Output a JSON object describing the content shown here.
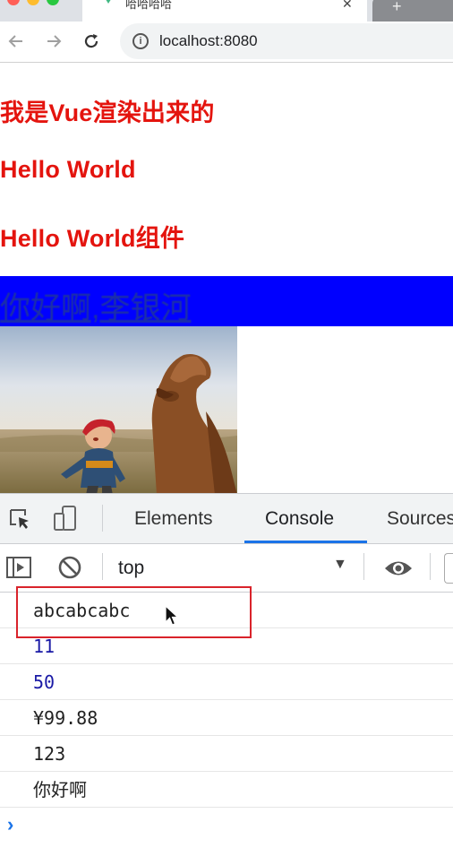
{
  "browser": {
    "tab_title": "哈哈哈哈",
    "url": "localhost:8080"
  },
  "page": {
    "headings": [
      "我是Vue渲染出来的",
      "Hello World",
      "Hello World组件"
    ],
    "blue_link_text": "你好啊,李银河"
  },
  "devtools": {
    "tabs": [
      "Elements",
      "Console",
      "Sources"
    ],
    "active_tab": "Console",
    "context": "top",
    "accent_color": "#1a73e8",
    "console_lines": [
      {
        "text": "abcabcabc",
        "kind": "string"
      },
      {
        "text": "11",
        "kind": "number"
      },
      {
        "text": "50",
        "kind": "number"
      },
      {
        "text": "¥99.88",
        "kind": "string"
      },
      {
        "text": "123",
        "kind": "string"
      },
      {
        "text": "你好啊",
        "kind": "string"
      }
    ],
    "prompt": "›"
  },
  "colors": {
    "heading_red": "#e4140e",
    "blue_bar": "#0000ff",
    "highlight_red": "#d9232b"
  }
}
